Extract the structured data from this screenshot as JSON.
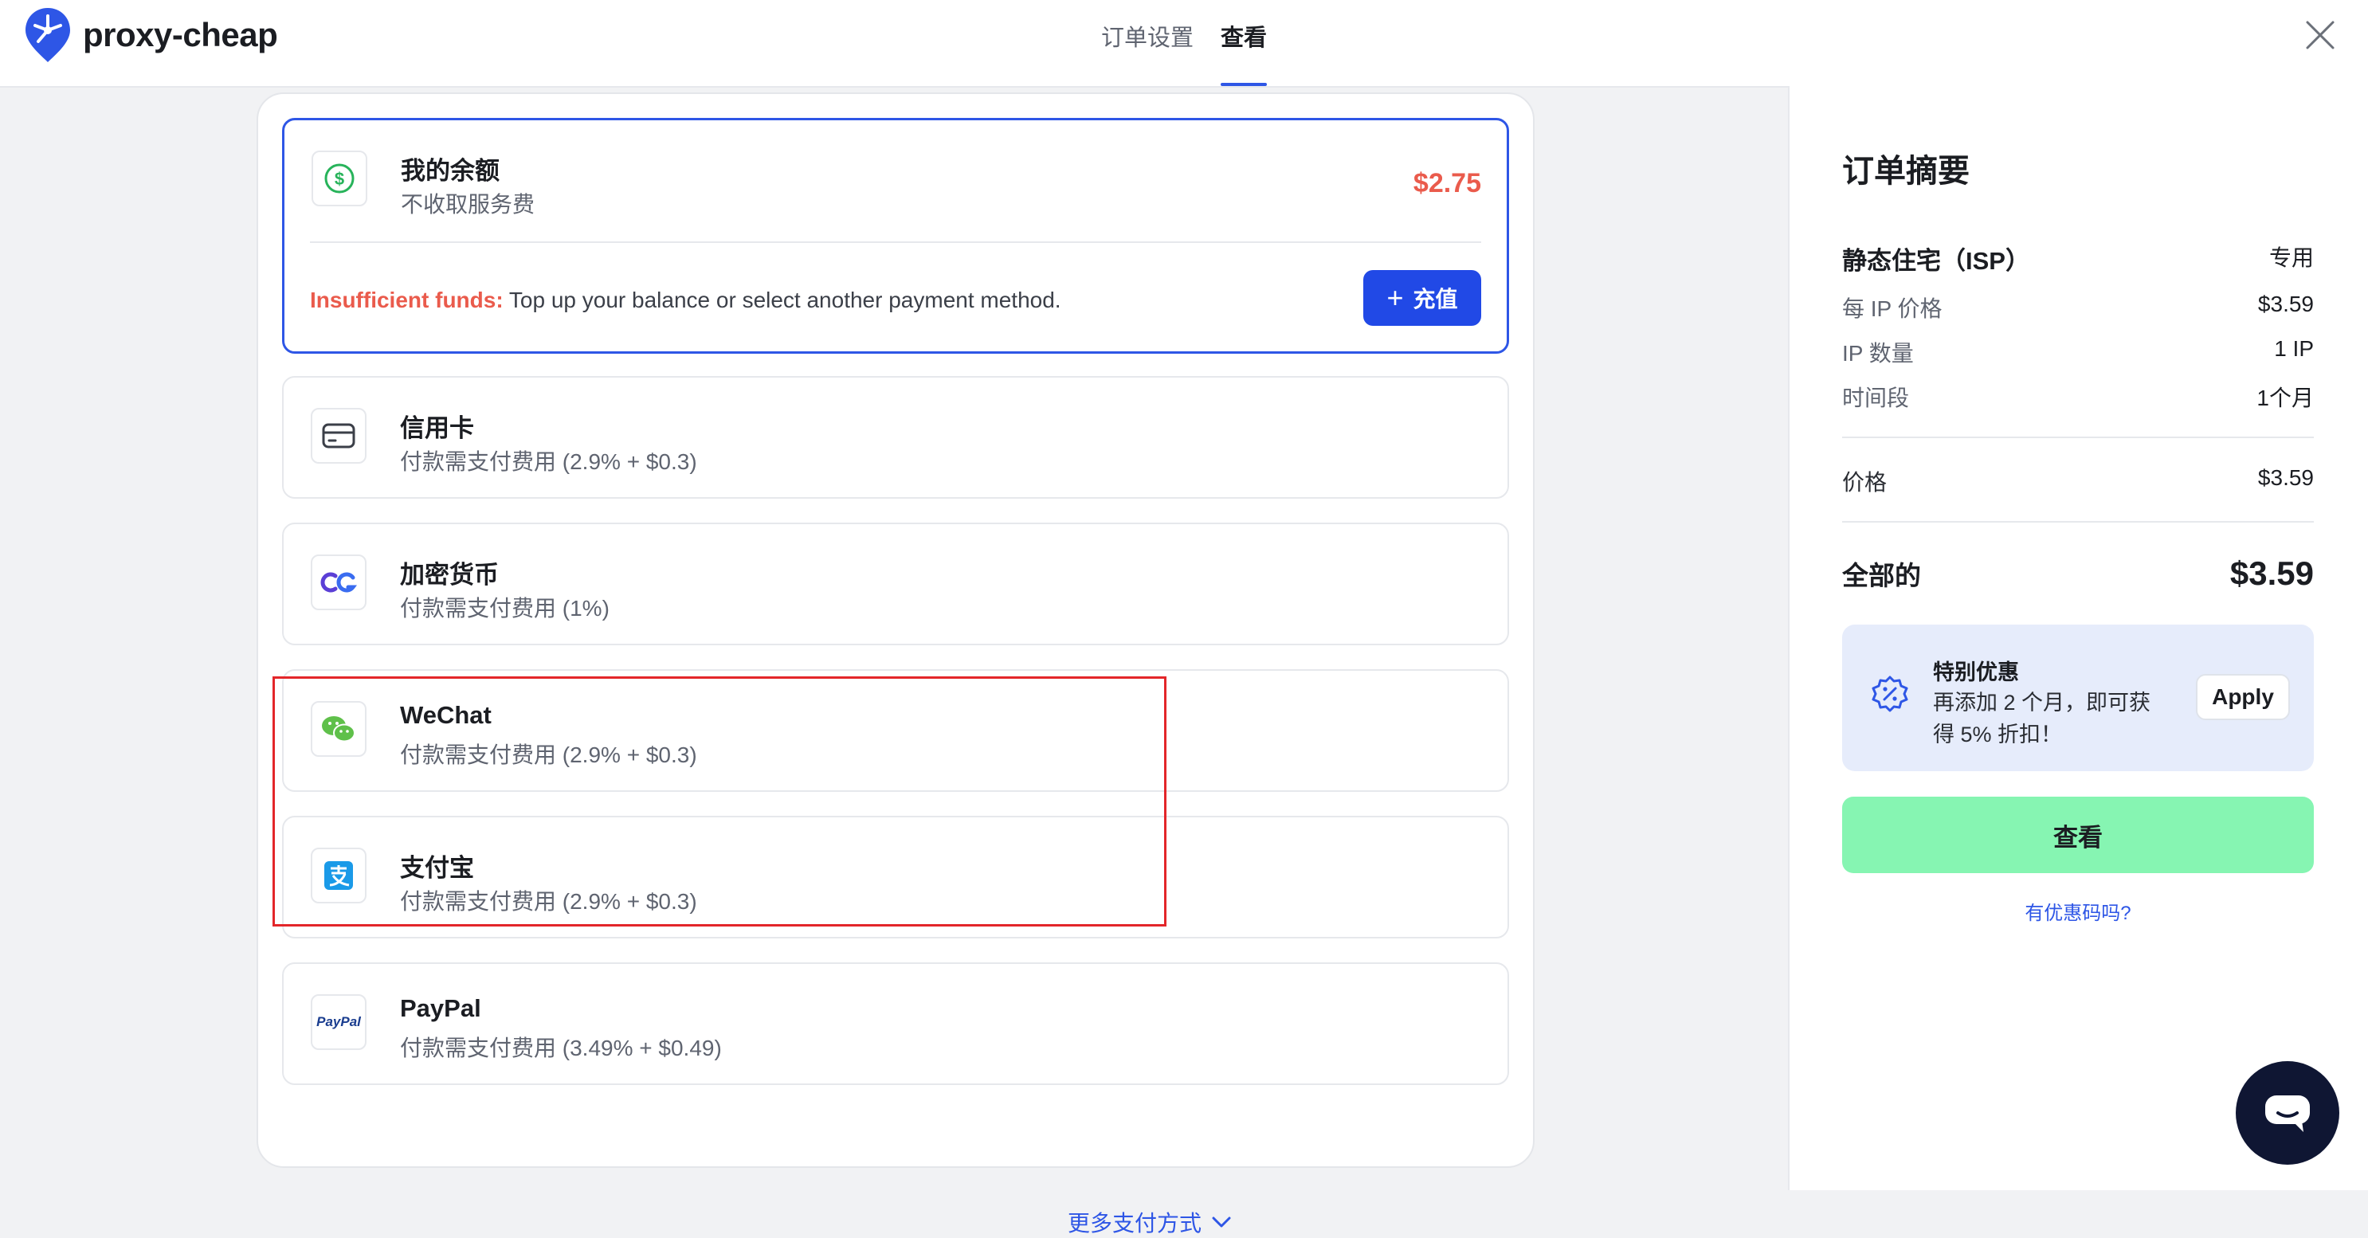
{
  "app": {
    "brand": "proxy-cheap"
  },
  "header": {
    "tabs": [
      {
        "label": "订单设置",
        "active": false
      },
      {
        "label": "查看",
        "active": true
      }
    ]
  },
  "payment_methods": {
    "balance": {
      "title": "我的余额",
      "subtitle": "不收取服务费",
      "amount": "$2.75",
      "warning_label": "Insufficient funds:",
      "warning_text": " Top up your balance or select another payment method.",
      "topup_label": "充值",
      "selected": true
    },
    "items": [
      {
        "name": "credit-card",
        "title": "信用卡",
        "subtitle": "付款需支付费用 (2.9% + $0.3)",
        "icon": "credit-card-icon"
      },
      {
        "name": "crypto",
        "title": "加密货币",
        "subtitle": "付款需支付费用 (1%)",
        "icon": "crypto-icon"
      },
      {
        "name": "wechat",
        "title": "WeChat",
        "subtitle": "付款需支付费用 (2.9% + $0.3)",
        "icon": "wechat-icon"
      },
      {
        "name": "alipay",
        "title": "支付宝",
        "subtitle": "付款需支付费用 (2.9% + $0.3)",
        "icon": "alipay-icon"
      },
      {
        "name": "paypal",
        "title": "PayPal",
        "subtitle": "付款需支付费用 (3.49% + $0.49)",
        "icon": "paypal-icon",
        "icon_text": "PayPal"
      }
    ],
    "more_label": "更多支付方式"
  },
  "summary": {
    "title": "订单摘要",
    "product": {
      "label": "静态住宅（ISP）",
      "value": "专用"
    },
    "rows": [
      {
        "label": "每 IP 价格",
        "value": "$3.59"
      },
      {
        "label": "IP 数量",
        "value": "1 IP"
      },
      {
        "label": "时间段",
        "value": "1个月"
      }
    ],
    "price": {
      "label": "价格",
      "value": "$3.59"
    },
    "total": {
      "label": "全部的",
      "value": "$3.59"
    },
    "promo": {
      "title": "特别优惠",
      "text": "再添加 2 个月，即可获得 5% 折扣！",
      "apply_label": "Apply"
    },
    "checkout_label": "查看",
    "coupon_link": "有优惠码吗?"
  },
  "colors": {
    "accent": "#2e56e6",
    "warning": "#ea5b4c",
    "checkout": "#86f5b2",
    "highlight": "#e3262a",
    "chat": "#0f1633"
  }
}
